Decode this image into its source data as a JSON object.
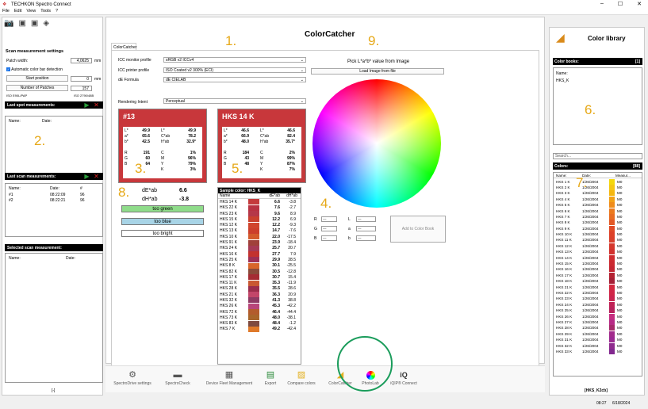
{
  "window": {
    "title": "TECHKON Spectro Connect",
    "minimize": "–",
    "maximize": "☐",
    "close": "✕"
  },
  "menu": [
    "File",
    "Edit",
    "View",
    "Tools",
    "?"
  ],
  "left": {
    "settings_title": "Scan measurement settings",
    "patch_width_label": "Patch width:",
    "patch_width_value": "4,0625",
    "patch_width_unit": "mm",
    "auto_color_bar": "Automatic color bar detection",
    "start_position_btn": "Start position",
    "start_position_value": "0",
    "start_position_unit": "mm",
    "num_patches_btn": "Number of Patches",
    "num_patches_value": "157",
    "iso_left": "ISO E90L/PAP",
    "iso_right": "ISO 2790/48B",
    "last_spot": "Last spot measurements:",
    "col_name": "Name:",
    "col_date": "Date:",
    "col_hash": "#",
    "last_scan": "Last scan measurements:",
    "scan_rows": [
      {
        "name": "#1",
        "date": "08:22:09",
        "n": "96"
      },
      {
        "name": "#2",
        "date": "08:22:21",
        "n": "96"
      }
    ],
    "selected_scan": "Selected scan measurement:",
    "bottom": "[-]"
  },
  "annotations": {
    "n1": "1.",
    "n2": "2.",
    "n3": "3.",
    "n4": "4.",
    "n5": "5.",
    "n6": "6.",
    "n7": "7.",
    "n8": "8.",
    "n9": "9."
  },
  "main": {
    "tab": "ColorCatcher",
    "title": "ColorCatcher",
    "icc_monitor_label": "ICC monitor profile",
    "icc_monitor_value": "sRGB v2 ICCv4",
    "icc_printer_label": "ICC printer profile",
    "icc_printer_value": "ISO Coated v2 300% (ECI)",
    "de_formula_label": "dE Formula",
    "de_formula_value": "dE CIELAB",
    "rendering_label": "Rendering Intent",
    "rendering_value": "Perceptual",
    "pick_title": "Pick L*a*b* value from Image",
    "load_image": "Load Image from file",
    "swatch1": {
      "title": "#13",
      "color": "#c8373b",
      "lab": [
        [
          "L*",
          "49.9",
          "L*",
          "49.9"
        ],
        [
          "a*",
          "65.6",
          "C*ab",
          "78.2"
        ],
        [
          "b*",
          "42.5",
          "h*ab",
          "32.9°"
        ]
      ],
      "rgbcmyk": [
        [
          "R",
          "191",
          "C",
          "1%"
        ],
        [
          "G",
          "60",
          "M",
          "96%"
        ],
        [
          "B",
          "64",
          "Y",
          "79%"
        ],
        [
          "",
          "",
          "K",
          "3%"
        ]
      ]
    },
    "swatch2": {
      "title": "HKS 14 K",
      "color": "#c43a3c",
      "lab": [
        [
          "L*",
          "46.6",
          "L*",
          "46.6"
        ],
        [
          "a*",
          "66.9",
          "C*ab",
          "82.4"
        ],
        [
          "b*",
          "48.0",
          "h*ab",
          "35.7°"
        ]
      ],
      "rgbcmyk": [
        [
          "R",
          "184",
          "C",
          "2%"
        ],
        [
          "G",
          "43",
          "M",
          "99%"
        ],
        [
          "B",
          "48",
          "Y",
          "87%"
        ],
        [
          "",
          "",
          "K",
          "7%"
        ]
      ]
    },
    "de_label": "dE*ab",
    "de_value": "6.6",
    "dh_label": "dH*ab",
    "dh_value": "-3.8",
    "too_green": "too green",
    "too_blue": "too blue",
    "too_bright": "too bright",
    "sample_header": "Sample color: HKS_K",
    "sample_cols": [
      "Name",
      "dE*ab",
      "dH*ab"
    ],
    "samples": [
      {
        "n": "HKS 14 K",
        "c": "#c43a3c",
        "de": "6.6",
        "dh": "-3.8"
      },
      {
        "n": "HKS 22 K",
        "c": "#b83242",
        "de": "7.6",
        "dh": "-2.7"
      },
      {
        "n": "HKS 23 K",
        "c": "#b53849",
        "de": "9.6",
        "dh": "8.9"
      },
      {
        "n": "HKS 15 K",
        "c": "#c9412f",
        "de": "12.2",
        "dh": "6.9"
      },
      {
        "n": "HKS 12 K",
        "c": "#d0452d",
        "de": "12.2",
        "dh": "-9.3"
      },
      {
        "n": "HKS 13 K",
        "c": "#cc3f2c",
        "de": "14.7",
        "dh": "-7.6"
      },
      {
        "n": "HKS 10 K",
        "c": "#d35b2c",
        "de": "22.0",
        "dh": "-17.5"
      },
      {
        "n": "HKS 91 K",
        "c": "#a0413a",
        "de": "23.9",
        "dh": "-18.4"
      },
      {
        "n": "HKS 24 K",
        "c": "#a63a55",
        "de": "25.7",
        "dh": "20.7"
      },
      {
        "n": "HKS 16 K",
        "c": "#c3322f",
        "de": "27.7",
        "dh": "7.9"
      },
      {
        "n": "HKS 25 K",
        "c": "#9e2f55",
        "de": "29.9",
        "dh": "28.5"
      },
      {
        "n": "HKS 8 K",
        "c": "#d8652a",
        "de": "30.1",
        "dh": "-25.5"
      },
      {
        "n": "HKS 82 K",
        "c": "#8b4a3a",
        "de": "30.5",
        "dh": "-12.8"
      },
      {
        "n": "HKS 17 K",
        "c": "#a52c33",
        "de": "30.7",
        "dh": "15.4"
      },
      {
        "n": "HKS 11 K",
        "c": "#c95832",
        "de": "35.3",
        "dh": "-11.9"
      },
      {
        "n": "HKS 28 K",
        "c": "#9b2d4c",
        "de": "35.5",
        "dh": "28.6"
      },
      {
        "n": "HKS 21 K",
        "c": "#c2466a",
        "de": "36.3",
        "dh": "20.9"
      },
      {
        "n": "HKS 32 K",
        "c": "#8e3a64",
        "de": "41.3",
        "dh": "38.8"
      },
      {
        "n": "HKS 26 K",
        "c": "#b8457a",
        "de": "45.3",
        "dh": "-42.2"
      },
      {
        "n": "HKS 72 K",
        "c": "#b35c2c",
        "de": "46.4",
        "dh": "-44.4"
      },
      {
        "n": "HKS 73 K",
        "c": "#a8662a",
        "de": "48.0",
        "dh": "-38.1"
      },
      {
        "n": "HKS 83 K",
        "c": "#7f4b40",
        "de": "48.4",
        "dh": "-1.2"
      },
      {
        "n": "HKS 7 K",
        "c": "#df7a2a",
        "de": "49.2",
        "dh": "-42.4"
      }
    ],
    "lab_inputs": {
      "R": "R",
      "G": "G",
      "B": "B",
      "L": "L",
      "a": "a",
      "b": "b",
      "dash": "---"
    },
    "add_btn": "Add to Color Book"
  },
  "toolbar": [
    {
      "label": "SpectroDrive settings",
      "icon": "⚙"
    },
    {
      "label": "SpectroCheck",
      "icon": "▬"
    },
    {
      "label": "Device Fleet Management",
      "icon": "▦"
    },
    {
      "label": "Export",
      "icon": "▤"
    },
    {
      "label": "Compare colors",
      "icon": "▨"
    },
    {
      "label": "ColorCatcher",
      "icon": "◢"
    },
    {
      "label": "PhotoLab",
      "icon": "●"
    },
    {
      "label": "iQIP® Connect",
      "icon": "iQ"
    }
  ],
  "right": {
    "title": "Color library",
    "books_header": "Color books:",
    "books_count": "[1]",
    "books_name": "Name:",
    "book": "HKS_K",
    "search": "Search...",
    "colors_header": "Colors:",
    "colors_count": "[88]",
    "col_name": "Name:",
    "col_date": "Date:",
    "col_meas": "Measur...",
    "colors": [
      {
        "n": "HKS 1 K",
        "c": "#f4d80c"
      },
      {
        "n": "HKS 2 K",
        "c": "#f5c714"
      },
      {
        "n": "HKS 3 K",
        "c": "#f5b70f"
      },
      {
        "n": "HKS 4 K",
        "c": "#f2a116"
      },
      {
        "n": "HKS 5 K",
        "c": "#ef8c1b"
      },
      {
        "n": "HKS 6 K",
        "c": "#ec7a1e"
      },
      {
        "n": "HKS 7 K",
        "c": "#e86d22"
      },
      {
        "n": "HKS 8 K",
        "c": "#e35a26"
      },
      {
        "n": "HKS 9 K",
        "c": "#e04b27"
      },
      {
        "n": "HKS 10 K",
        "c": "#dd4128"
      },
      {
        "n": "HKS 11 K",
        "c": "#d9402c"
      },
      {
        "n": "HKS 12 K",
        "c": "#d5382d"
      },
      {
        "n": "HKS 13 K",
        "c": "#d2322e"
      },
      {
        "n": "HKS 14 K",
        "c": "#cf2c30"
      },
      {
        "n": "HKS 15 K",
        "c": "#cb2a31"
      },
      {
        "n": "HKS 16 K",
        "c": "#c42633"
      },
      {
        "n": "HKS 17 K",
        "c": "#b42232"
      },
      {
        "n": "HKS 18 K",
        "c": "#a61f35"
      },
      {
        "n": "HKS 21 K",
        "c": "#d3283e"
      },
      {
        "n": "HKS 22 K",
        "c": "#d02647"
      },
      {
        "n": "HKS 23 K",
        "c": "#c9244f"
      },
      {
        "n": "HKS 24 K",
        "c": "#c02357"
      },
      {
        "n": "HKS 25 K",
        "c": "#b8225d"
      },
      {
        "n": "HKS 26 K",
        "c": "#c52e80"
      },
      {
        "n": "HKS 27 K",
        "c": "#b72a86"
      },
      {
        "n": "HKS 28 K",
        "c": "#a6296a"
      },
      {
        "n": "HKS 29 K",
        "c": "#a22b8c"
      },
      {
        "n": "HKS 31 K",
        "c": "#9b2a92"
      },
      {
        "n": "HKS 32 K",
        "c": "#8f2b8e"
      },
      {
        "n": "HKS 33 K",
        "c": "#82288f"
      }
    ],
    "date": "1/26/2004",
    "meas": "M0",
    "bottom": "[HKS_K2cb]"
  },
  "status": {
    "time": "08:27",
    "date": "6/18/2024"
  }
}
